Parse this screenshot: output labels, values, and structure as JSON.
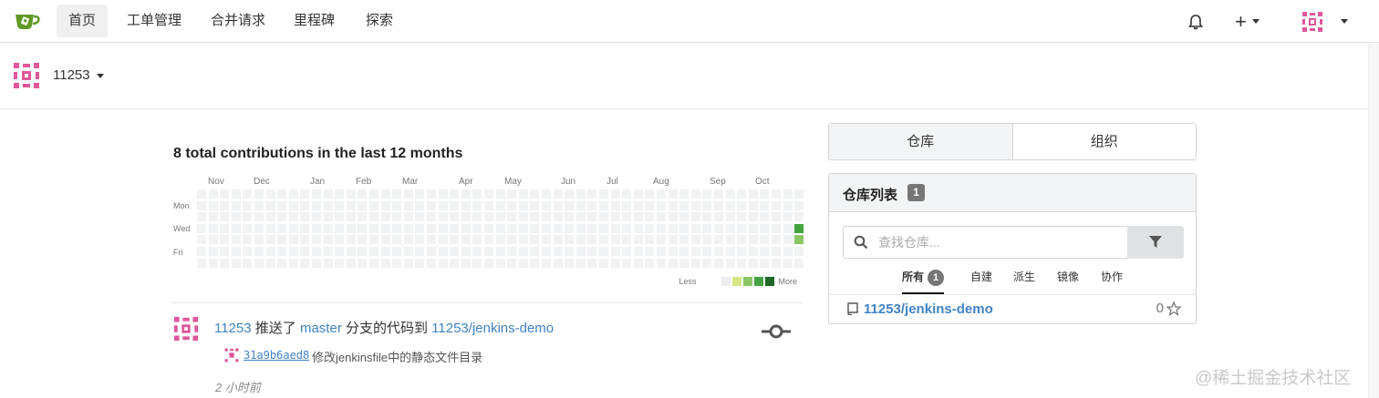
{
  "nav": {
    "items": [
      {
        "label": "首页",
        "active": true
      },
      {
        "label": "工单管理",
        "active": false
      },
      {
        "label": "合并请求",
        "active": false
      },
      {
        "label": "里程碑",
        "active": false
      },
      {
        "label": "探索",
        "active": false
      }
    ],
    "plus_label": "+",
    "icons": {
      "logo": "gitea-tea-icon",
      "bell": "bell-icon",
      "avatar": "identicon-avatar"
    }
  },
  "user": {
    "name": "11253"
  },
  "heatmap": {
    "title": "8 total contributions in the last 12 months",
    "months": [
      "Nov",
      "Dec",
      "Jan",
      "Feb",
      "Mar",
      "Apr",
      "May",
      "Jun",
      "Jul",
      "Aug",
      "Sep",
      "Oct"
    ],
    "weekdays": [
      "Mon",
      "Wed",
      "Fri"
    ],
    "legend_less": "Less",
    "legend_more": "More",
    "colors": [
      "#ebedf0",
      "#d6e685",
      "#8cc665",
      "#44a340",
      "#1e6823"
    ],
    "active_cells": [
      {
        "week": 52,
        "day": 3,
        "level": 3
      },
      {
        "week": 52,
        "day": 4,
        "level": 2
      }
    ]
  },
  "feed": {
    "actor": "11253",
    "verb": "推送了",
    "branch": "master",
    "mid": "分支的代码到",
    "repo": "11253/jenkins-demo",
    "commit_sha": "31a9b6aed8",
    "commit_message": "修改jenkinsfile中的静态文件目录",
    "time": "2 小时前"
  },
  "panel": {
    "tabs": [
      {
        "label": "仓库",
        "active": true
      },
      {
        "label": "组织",
        "active": false
      }
    ],
    "repo_list_title": "仓库列表",
    "repo_count": "1",
    "search_placeholder": "查找仓库...",
    "filters": [
      {
        "label": "所有",
        "count": "1",
        "active": true
      },
      {
        "label": "自建"
      },
      {
        "label": "派生"
      },
      {
        "label": "镜像"
      },
      {
        "label": "协作"
      }
    ],
    "repos": [
      {
        "name": "11253/jenkins-demo",
        "stars": "0"
      }
    ]
  },
  "watermark": "@稀土掘金技术社区",
  "accent": "#4183c4"
}
